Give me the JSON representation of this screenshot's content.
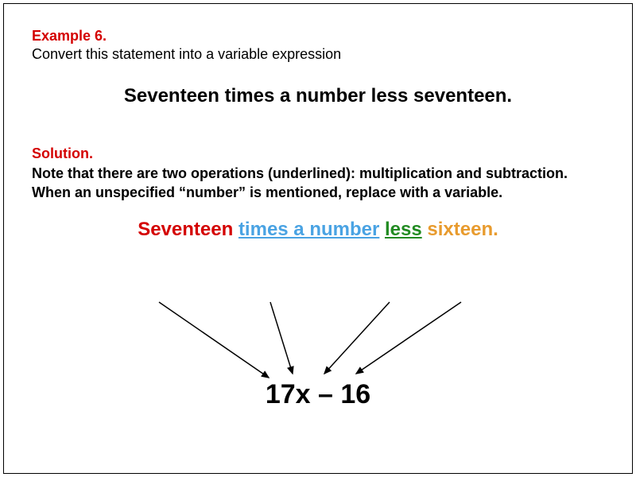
{
  "example": {
    "label": "Example 6.",
    "prompt": "Convert this statement into a variable expression",
    "statement": "Seventeen times a number less seventeen."
  },
  "solution": {
    "label": "Solution.",
    "text": "Note that there are two operations (underlined): multiplication and subtraction. When an unspecified “number” is mentioned, replace with a variable.",
    "colored": {
      "w1": "Seventeen",
      "w2": "times a number",
      "w3": "less",
      "w4": "sixteen",
      "period": "."
    },
    "expression": "17x – 16"
  },
  "colors": {
    "red": "#d40000",
    "blue": "#4aa3e3",
    "green": "#228b22",
    "orange": "#e89b2e"
  }
}
